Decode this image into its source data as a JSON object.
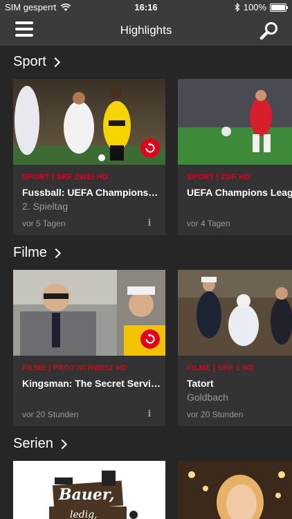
{
  "status": {
    "carrier": "SIM gesperrt",
    "time": "16:16",
    "battery": "100%",
    "battery_level": 1.0
  },
  "navbar": {
    "title": "Highlights",
    "menu_icon": "menu-icon",
    "search_icon": "search-icon"
  },
  "sections": [
    {
      "title": "Sport",
      "cards": [
        {
          "channel": "SPORT | SRF ZWEI HD",
          "title": "Fussball: UEFA Champions League",
          "subtitle": "2. Spieltag",
          "time": "vor 5 Tagen",
          "replay": true,
          "info": "i"
        },
        {
          "channel": "SPORT | ZDF HD",
          "title": "UEFA Champions League",
          "subtitle": "",
          "time": "vor 4 Tagen",
          "replay": false,
          "info": ""
        }
      ]
    },
    {
      "title": "Filme",
      "cards": [
        {
          "channel": "FILME | PRO7 SCHWEIZ HD",
          "title": "Kingsman: The Secret Service",
          "subtitle": "",
          "time": "vor 20 Stunden",
          "replay": true,
          "info": "i"
        },
        {
          "channel": "FILME | SRF 1 HD",
          "title": "Tatort",
          "subtitle": "Goldbach",
          "time": "vor 20 Stunden",
          "replay": false,
          "info": ""
        }
      ]
    },
    {
      "title": "Serien",
      "cards": [
        {
          "thumb_text_1": "Bauer,",
          "thumb_text_2": "ledig,"
        },
        {}
      ]
    }
  ],
  "colors": {
    "accent": "#e3001b",
    "background": "#262626",
    "bar": "#3b3b3b",
    "card": "#333333"
  }
}
